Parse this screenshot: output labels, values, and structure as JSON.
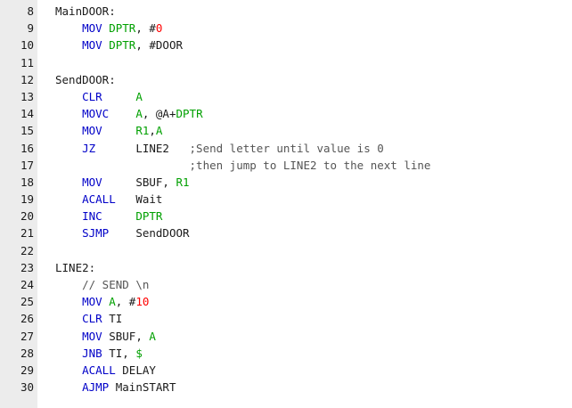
{
  "colors": {
    "gutter_bg": "#ececec",
    "keyword": "#0000c8",
    "register": "#00a000",
    "number": "#ff0000",
    "text": "#1a1a1a",
    "comment": "#555555"
  },
  "lines": [
    {
      "num": "8",
      "tokens": [
        {
          "t": "label",
          "v": "MainDOOR:"
        }
      ]
    },
    {
      "num": "9",
      "tokens": [
        {
          "t": "txt",
          "v": "    "
        },
        {
          "t": "kw",
          "v": "MOV"
        },
        {
          "t": "txt",
          "v": " "
        },
        {
          "t": "reg",
          "v": "DPTR"
        },
        {
          "t": "txt",
          "v": ", #"
        },
        {
          "t": "num",
          "v": "0"
        }
      ]
    },
    {
      "num": "10",
      "tokens": [
        {
          "t": "txt",
          "v": "    "
        },
        {
          "t": "kw",
          "v": "MOV"
        },
        {
          "t": "txt",
          "v": " "
        },
        {
          "t": "reg",
          "v": "DPTR"
        },
        {
          "t": "txt",
          "v": ", #DOOR"
        }
      ]
    },
    {
      "num": "11",
      "tokens": []
    },
    {
      "num": "12",
      "tokens": [
        {
          "t": "label",
          "v": "SendDOOR:"
        }
      ]
    },
    {
      "num": "13",
      "tokens": [
        {
          "t": "txt",
          "v": "    "
        },
        {
          "t": "kw",
          "v": "CLR"
        },
        {
          "t": "txt",
          "v": "     "
        },
        {
          "t": "reg",
          "v": "A"
        }
      ]
    },
    {
      "num": "14",
      "tokens": [
        {
          "t": "txt",
          "v": "    "
        },
        {
          "t": "kw",
          "v": "MOVC"
        },
        {
          "t": "txt",
          "v": "    "
        },
        {
          "t": "reg",
          "v": "A"
        },
        {
          "t": "txt",
          "v": ", @A+"
        },
        {
          "t": "reg",
          "v": "DPTR"
        }
      ]
    },
    {
      "num": "15",
      "tokens": [
        {
          "t": "txt",
          "v": "    "
        },
        {
          "t": "kw",
          "v": "MOV"
        },
        {
          "t": "txt",
          "v": "     "
        },
        {
          "t": "reg",
          "v": "R1"
        },
        {
          "t": "txt",
          "v": ","
        },
        {
          "t": "reg",
          "v": "A"
        }
      ]
    },
    {
      "num": "16",
      "tokens": [
        {
          "t": "txt",
          "v": "    "
        },
        {
          "t": "kw",
          "v": "JZ"
        },
        {
          "t": "txt",
          "v": "      LINE2   "
        },
        {
          "t": "com",
          "v": ";Send letter until value is 0"
        }
      ]
    },
    {
      "num": "17",
      "tokens": [
        {
          "t": "txt",
          "v": "                    "
        },
        {
          "t": "com",
          "v": ";then jump to LINE2 to the next line"
        }
      ]
    },
    {
      "num": "18",
      "tokens": [
        {
          "t": "txt",
          "v": "    "
        },
        {
          "t": "kw",
          "v": "MOV"
        },
        {
          "t": "txt",
          "v": "     SBUF, "
        },
        {
          "t": "reg",
          "v": "R1"
        }
      ]
    },
    {
      "num": "19",
      "tokens": [
        {
          "t": "txt",
          "v": "    "
        },
        {
          "t": "kw",
          "v": "ACALL"
        },
        {
          "t": "txt",
          "v": "   Wait"
        }
      ]
    },
    {
      "num": "20",
      "tokens": [
        {
          "t": "txt",
          "v": "    "
        },
        {
          "t": "kw",
          "v": "INC"
        },
        {
          "t": "txt",
          "v": "     "
        },
        {
          "t": "reg",
          "v": "DPTR"
        }
      ]
    },
    {
      "num": "21",
      "tokens": [
        {
          "t": "txt",
          "v": "    "
        },
        {
          "t": "kw",
          "v": "SJMP"
        },
        {
          "t": "txt",
          "v": "    SendDOOR"
        }
      ]
    },
    {
      "num": "22",
      "tokens": []
    },
    {
      "num": "23",
      "tokens": [
        {
          "t": "label",
          "v": "LINE2:"
        }
      ]
    },
    {
      "num": "24",
      "tokens": [
        {
          "t": "txt",
          "v": "    "
        },
        {
          "t": "com",
          "v": "// SEND \\n"
        }
      ]
    },
    {
      "num": "25",
      "tokens": [
        {
          "t": "txt",
          "v": "    "
        },
        {
          "t": "kw",
          "v": "MOV"
        },
        {
          "t": "txt",
          "v": " "
        },
        {
          "t": "reg",
          "v": "A"
        },
        {
          "t": "txt",
          "v": ", #"
        },
        {
          "t": "num",
          "v": "10"
        }
      ]
    },
    {
      "num": "26",
      "tokens": [
        {
          "t": "txt",
          "v": "    "
        },
        {
          "t": "kw",
          "v": "CLR"
        },
        {
          "t": "txt",
          "v": " TI"
        }
      ]
    },
    {
      "num": "27",
      "tokens": [
        {
          "t": "txt",
          "v": "    "
        },
        {
          "t": "kw",
          "v": "MOV"
        },
        {
          "t": "txt",
          "v": " SBUF, "
        },
        {
          "t": "reg",
          "v": "A"
        }
      ]
    },
    {
      "num": "28",
      "tokens": [
        {
          "t": "txt",
          "v": "    "
        },
        {
          "t": "kw",
          "v": "JNB"
        },
        {
          "t": "txt",
          "v": " TI, "
        },
        {
          "t": "reg",
          "v": "$"
        }
      ]
    },
    {
      "num": "29",
      "tokens": [
        {
          "t": "txt",
          "v": "    "
        },
        {
          "t": "kw",
          "v": "ACALL"
        },
        {
          "t": "txt",
          "v": " DELAY"
        }
      ]
    },
    {
      "num": "30",
      "tokens": [
        {
          "t": "txt",
          "v": "    "
        },
        {
          "t": "kw",
          "v": "AJMP"
        },
        {
          "t": "txt",
          "v": " MainSTART"
        }
      ]
    }
  ]
}
